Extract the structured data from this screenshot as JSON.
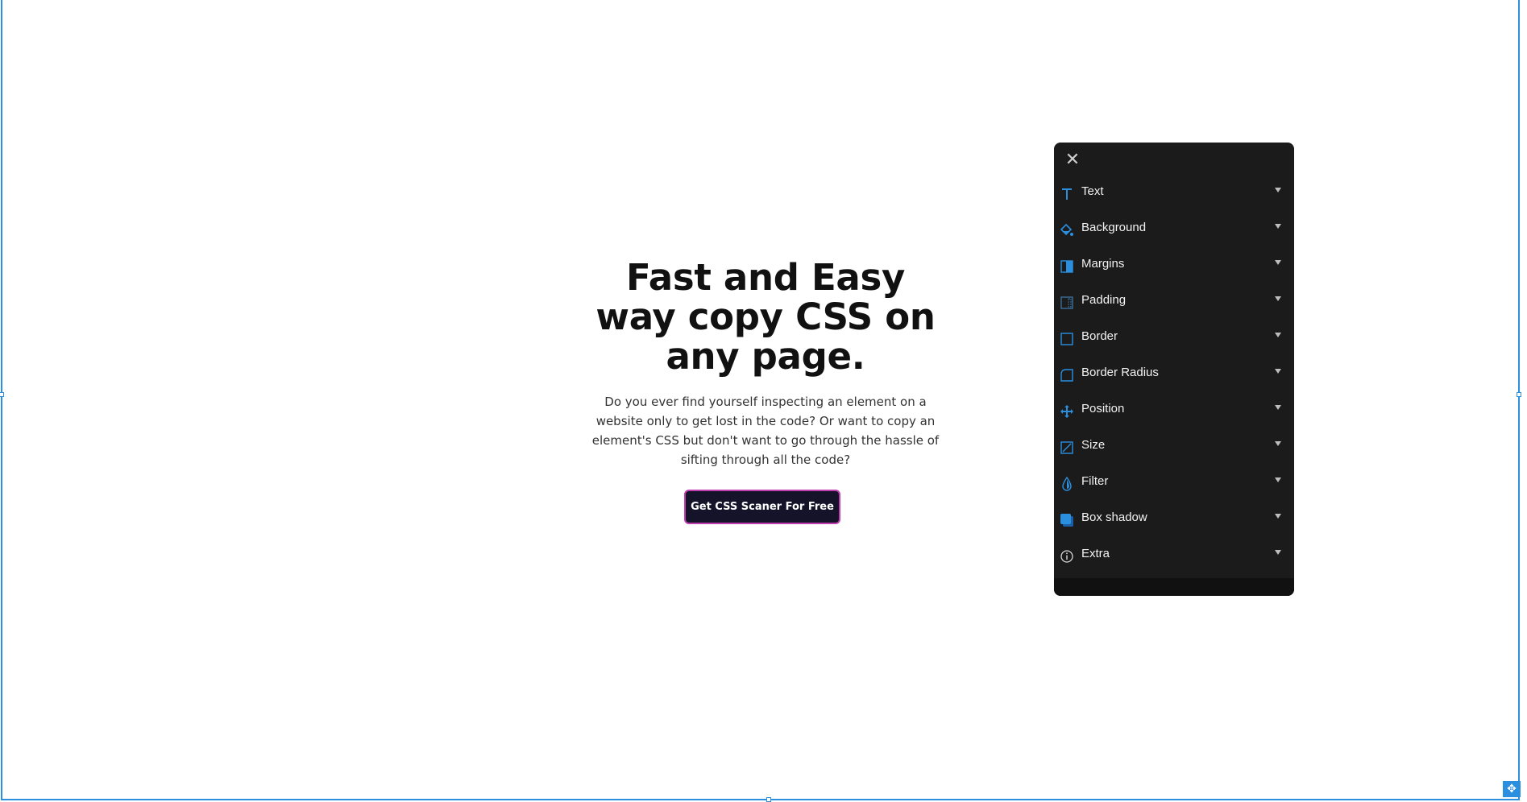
{
  "hero": {
    "title": "Fast and Easy way copy CSS on any page.",
    "description": "Do you ever find yourself inspecting an element on a website only to get lost in the code? Or want to copy an element's CSS but don't want to go through the hassle of sifting through all the code?",
    "cta_label": "Get CSS Scaner For Free"
  },
  "panel": {
    "close_icon": "close-icon",
    "items": [
      {
        "label": "Text",
        "icon": "text-icon"
      },
      {
        "label": "Background",
        "icon": "paint-bucket-icon"
      },
      {
        "label": "Margins",
        "icon": "margins-icon"
      },
      {
        "label": "Padding",
        "icon": "padding-icon"
      },
      {
        "label": "Border",
        "icon": "border-icon"
      },
      {
        "label": "Border Radius",
        "icon": "border-radius-icon"
      },
      {
        "label": "Position",
        "icon": "move-icon"
      },
      {
        "label": "Size",
        "icon": "resize-icon"
      },
      {
        "label": "Filter",
        "icon": "droplet-icon"
      },
      {
        "label": "Box shadow",
        "icon": "box-shadow-icon"
      },
      {
        "label": "Extra",
        "icon": "info-icon"
      }
    ]
  },
  "colors": {
    "accent": "#2b8fe0",
    "panel_bg": "#1b1b1b",
    "cta_bg": "#14132a",
    "cta_border": "#c13eb0"
  }
}
